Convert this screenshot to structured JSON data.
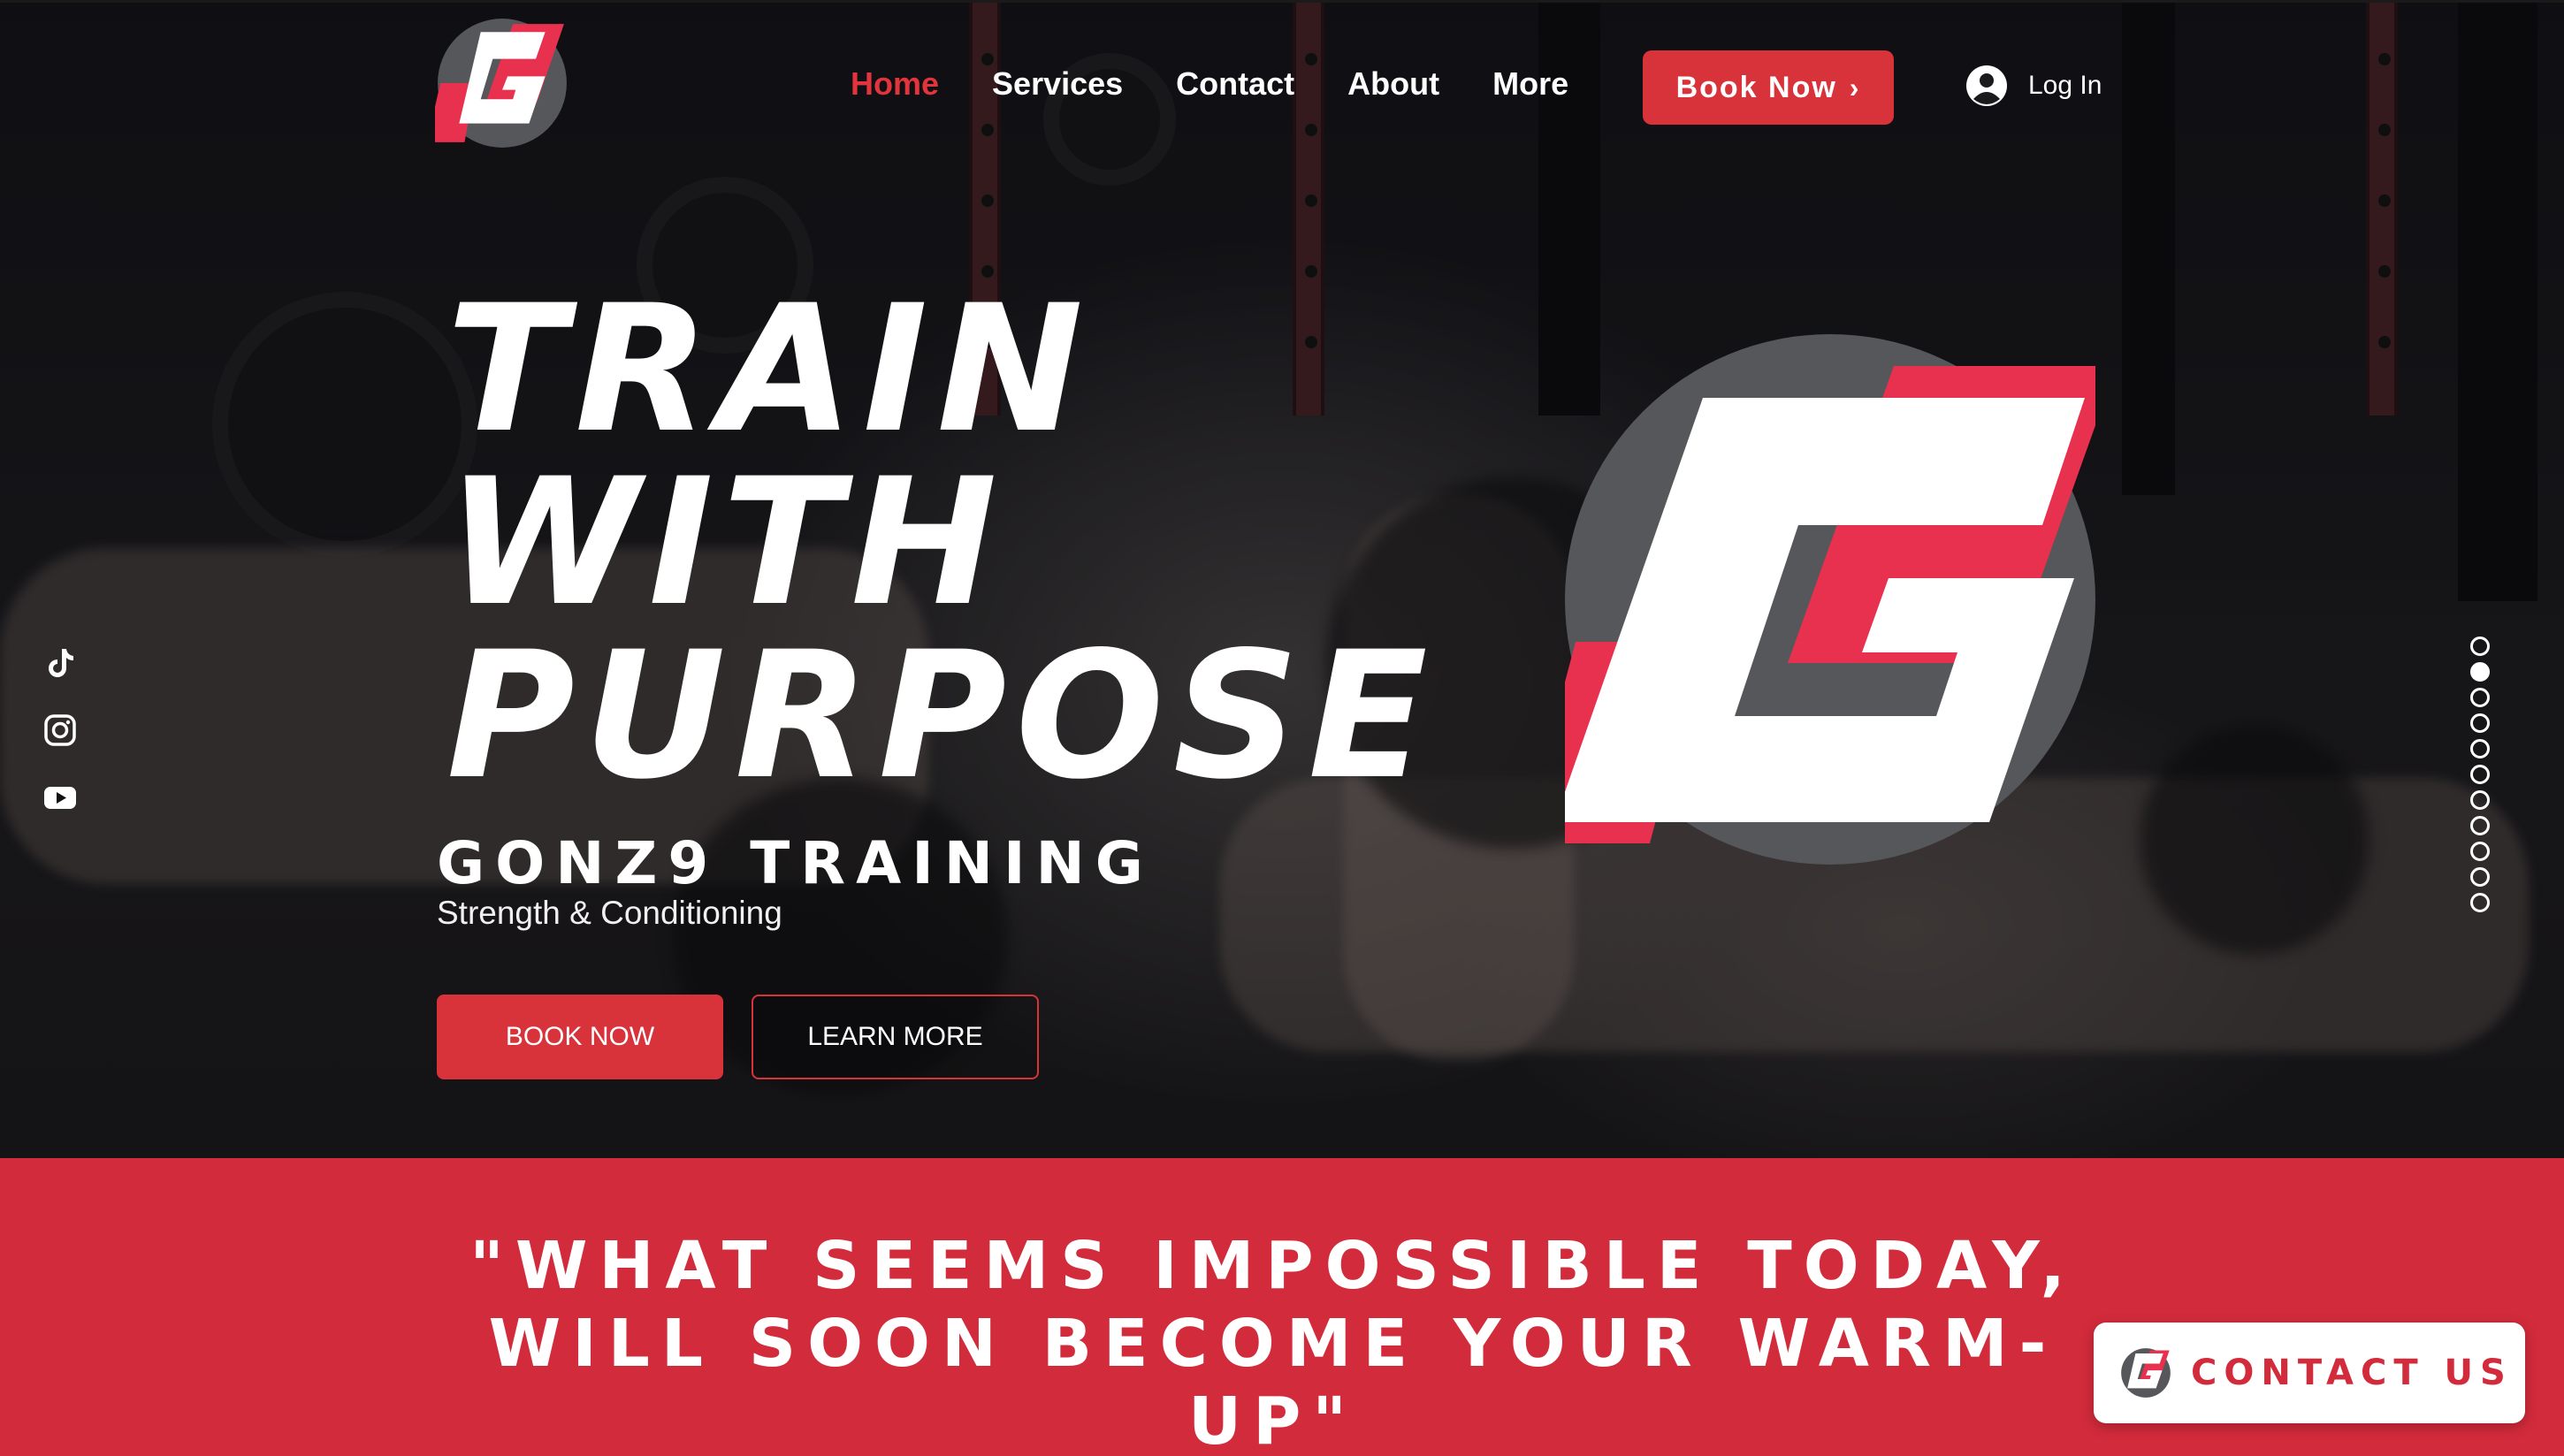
{
  "header": {
    "nav": [
      {
        "label": "Home",
        "active": true
      },
      {
        "label": "Services",
        "active": false
      },
      {
        "label": "Contact",
        "active": false
      },
      {
        "label": "About",
        "active": false
      },
      {
        "label": "More",
        "active": false
      }
    ],
    "book_now_label": "Book Now",
    "login_label": "Log In"
  },
  "hero": {
    "headline_lines": [
      "TRAIN",
      "WITH",
      "PURPOSE"
    ],
    "brand_name": "GONZ9 TRAINING",
    "tagline": "Strength & Conditioning",
    "book_button": "BOOK NOW",
    "learn_button": "LEARN MORE"
  },
  "social": {
    "icons": [
      "tiktok-icon",
      "instagram-icon",
      "youtube-icon"
    ]
  },
  "page_dots": {
    "count": 11,
    "active_index": 1
  },
  "quote_band": {
    "quote": "\"WHAT SEEMS IMPOSSIBLE TODAY, WILL SOON BECOME YOUR WARM-UP\""
  },
  "contact_widget": {
    "label": "CONTACT US"
  },
  "colors": {
    "accent_red": "#d8323a",
    "band_red": "#d22b3b",
    "active_nav": "#e2343d",
    "logo_gray": "#55575a",
    "logo_pink": "#e8304f"
  }
}
